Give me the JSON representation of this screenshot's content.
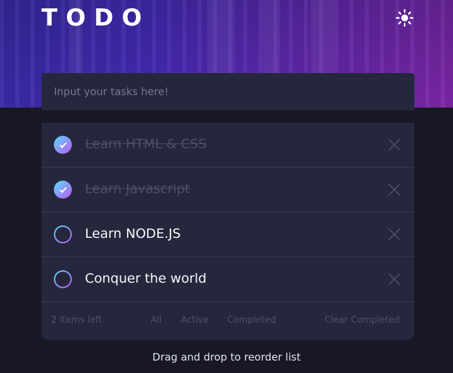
{
  "header": {
    "title": "TODO",
    "theme_icon": "sun-icon"
  },
  "input": {
    "placeholder": "Input your tasks here!",
    "value": ""
  },
  "todos": [
    {
      "label": "Learn HTML & CSS",
      "completed": true
    },
    {
      "label": "Learn Javascript",
      "completed": true
    },
    {
      "label": "Learn NODE.JS",
      "completed": false
    },
    {
      "label": "Conquer the world",
      "completed": false
    }
  ],
  "footer": {
    "items_left": "2 items left",
    "filter_all": "All",
    "filter_active": "Active",
    "filter_completed": "Completed",
    "clear_completed": "Clear Completed"
  },
  "hint": "Drag and drop to reorder list",
  "colors": {
    "accent_start": "#55ddff",
    "accent_end": "#c058f3",
    "card": "#25273d",
    "background": "#171823"
  }
}
